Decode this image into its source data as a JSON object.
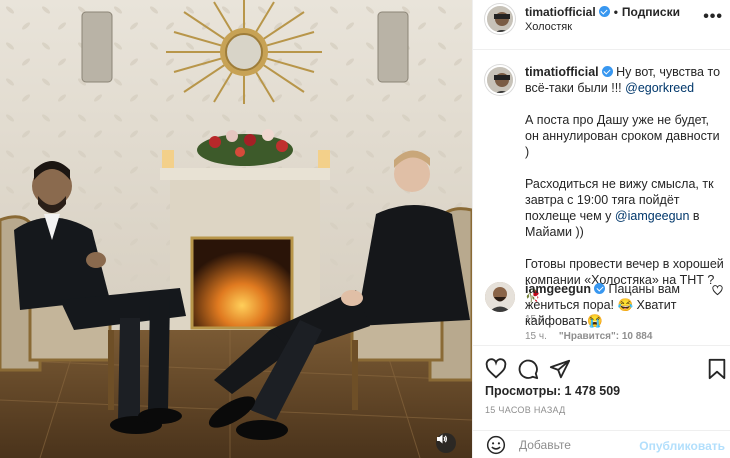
{
  "post": {
    "username": "timatiofficial",
    "follow_label": "Подписки",
    "location": "Холостяк",
    "more_label": "•••"
  },
  "caption": {
    "username": "timatiofficial",
    "line1": "Ну вот, чувства то всё-таки были !!! ",
    "mention1": "@egorkreed",
    "para2": "А поста про Дашу уже не будет, он аннулирован сроком давности )",
    "para3_before": "Расходиться не вижу смысла, тк завтра с 19:00 тяга пойдёт похлеще чем у ",
    "mention2": "@iamgeegun",
    "para3_after": " в Майами ))",
    "para4": "Готовы провести вечер в хорошей компании «Холостяка» на ТНТ ?🥀",
    "time": "15 ч."
  },
  "comment": {
    "username": "iamgeegun",
    "text": "Пацаны вам жениться пора! 😂 Хватит кайфовать😭",
    "time": "15 ч.",
    "likes": "\"Нравится\": 10 884"
  },
  "stats": {
    "views": "Просмотры: 1 478 509",
    "ago": "15 ЧАСОВ НАЗАД"
  },
  "add_comment": {
    "placeholder": "Добавьте",
    "publish_label": "Опубликовать"
  },
  "icons": {
    "like": "heart-icon",
    "comment": "comment-icon",
    "share": "paper-plane-icon",
    "save": "bookmark-icon",
    "sound": "speaker-icon",
    "emoji": "emoji-icon"
  },
  "colors": {
    "link": "#00376b",
    "verified": "#3897f0",
    "publish_disabled": "#b2dffc",
    "muted": "#8e8e8e"
  }
}
